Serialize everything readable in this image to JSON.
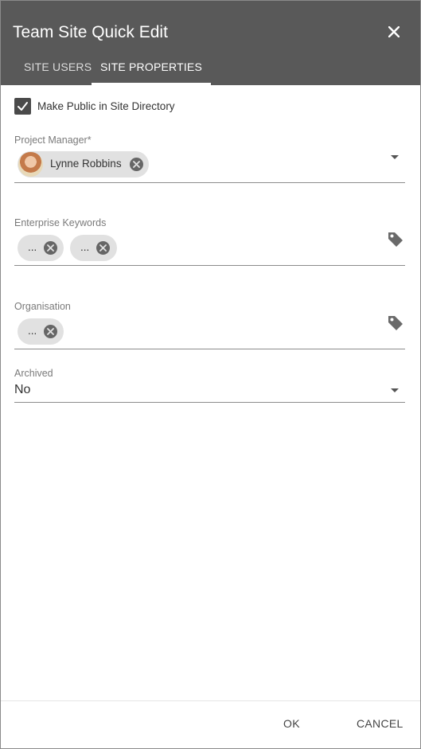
{
  "dialog": {
    "title": "Team Site Quick Edit",
    "close_glyph": "✕",
    "tabs": [
      {
        "label": "SITE USERS",
        "active": false
      },
      {
        "label": "SITE PROPERTIES",
        "active": true
      }
    ]
  },
  "form": {
    "make_public": {
      "label": "Make Public in Site Directory",
      "checked": true
    },
    "project_manager": {
      "label": "Project Manager*",
      "people": [
        {
          "name": "Lynne Robbins"
        }
      ]
    },
    "enterprise_keywords": {
      "label": "Enterprise Keywords",
      "terms": [
        {
          "text": "..."
        },
        {
          "text": "..."
        }
      ]
    },
    "organisation": {
      "label": "Organisation",
      "terms": [
        {
          "text": "..."
        }
      ]
    },
    "archived": {
      "label": "Archived",
      "value": "No"
    }
  },
  "footer": {
    "ok_label": "OK",
    "cancel_label": "CANCEL"
  },
  "colors": {
    "header_bg": "#595959",
    "chip_bg": "#e1e1e1",
    "checkbox_bg": "#4a4a4a"
  },
  "icons": [
    "close-icon",
    "checkmark-icon",
    "chevron-down-icon",
    "tag-icon",
    "remove-icon"
  ]
}
